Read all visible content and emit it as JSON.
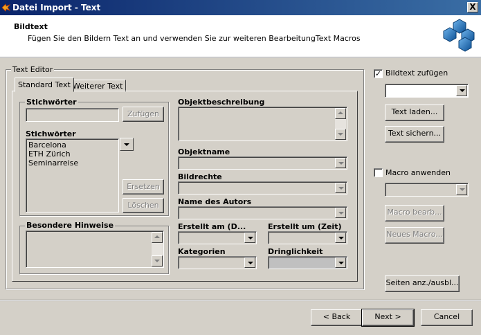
{
  "window": {
    "title": "Datei Import - Text",
    "close_label": "X"
  },
  "header": {
    "title": "Bildtext",
    "subtitle": "Fügen Sie den Bildern Text an und verwenden Sie zur weiteren BearbeitungText Macros"
  },
  "text_editor": {
    "group_label": "Text Editor",
    "tabs": [
      {
        "label": "Standard Text",
        "active": true
      },
      {
        "label": "Weiterer Text",
        "active": false
      }
    ],
    "keywords_box": {
      "label": "Stichwörter",
      "add_button": "Zufügen",
      "list_label": "Stichwörter",
      "items": [
        "Barcelona",
        "ETH Zürich",
        "Seminarreise"
      ],
      "replace_button": "Ersetzen",
      "delete_button": "Löschen"
    },
    "special_notes_label": "Besondere Hinweise",
    "fields": {
      "object_description": "Objektbeschreibung",
      "object_name": "Objektname",
      "image_rights": "Bildrechte",
      "author_name": "Name des Autors",
      "created_date": "Erstellt am (D...",
      "created_time": "Erstellt um (Zeit)",
      "categories": "Kategorien",
      "urgency": "Dringlichkeit"
    }
  },
  "right_panel": {
    "add_caption_label": "Bildtext zufügen",
    "add_caption_checked": true,
    "load_text_button": "Text laden...",
    "save_text_button": "Text sichern...",
    "apply_macro_label": "Macro anwenden",
    "apply_macro_checked": false,
    "edit_macro_button": "Macro bearb...",
    "new_macro_button": "Neues Macro...",
    "toggle_pages_button": "Seiten anz./ausbl..."
  },
  "footer": {
    "back_button": "< Back",
    "next_button": "Next >",
    "cancel_button": "Cancel"
  },
  "colors": {
    "titlebar_start": "#0a246a",
    "titlebar_end": "#3a6ea5",
    "dialog_bg": "#d4d0c8",
    "logo_hex_fill": "#1e6fb8"
  }
}
